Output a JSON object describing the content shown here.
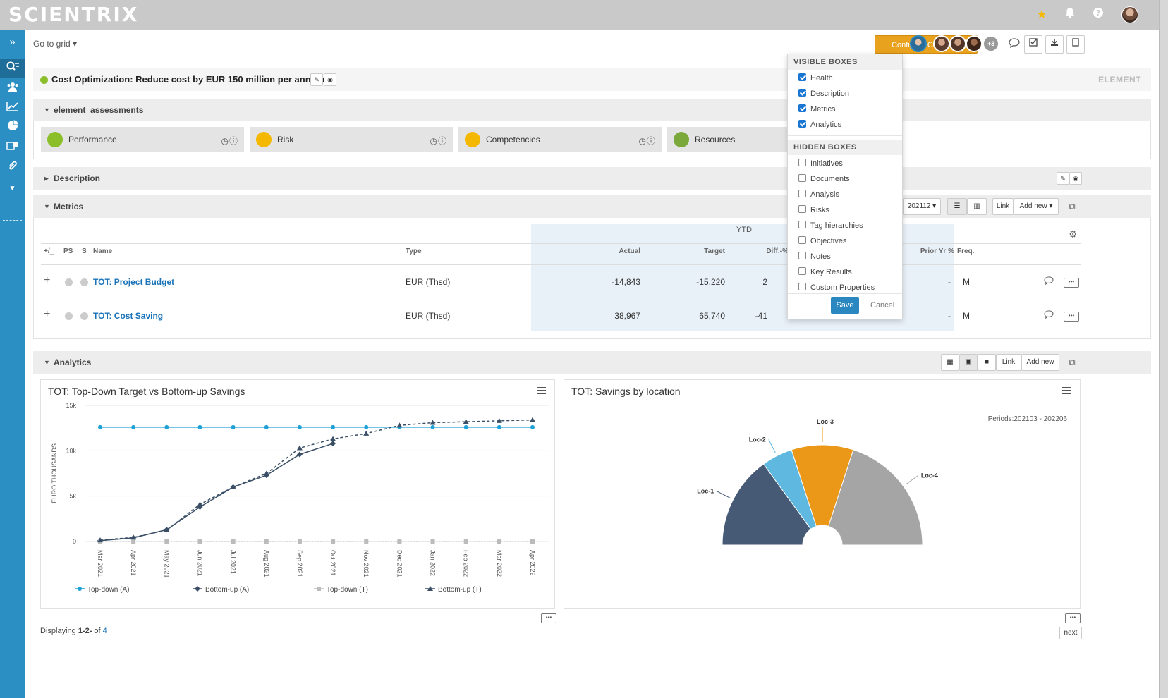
{
  "app": {
    "logo": "SCIENTRIX"
  },
  "topbar": {
    "icons": [
      "star-icon",
      "bell-icon",
      "help-icon",
      "user-avatar"
    ]
  },
  "nav": {
    "goto_grid": "Go to grid ▾"
  },
  "toolbar": {
    "configure_label": "Configure Content ▾",
    "more_users": "+3"
  },
  "element": {
    "title": "Cost Optimization: Reduce cost by EUR 150 million per annum",
    "type_label": "ELEMENT",
    "health_color": "#8bbf2a"
  },
  "sections": {
    "assessments": "element_assessments",
    "description": "Description",
    "metrics": "Metrics",
    "analytics": "Analytics"
  },
  "assessments": [
    {
      "label": "Performance",
      "color": "#8bbf2a"
    },
    {
      "label": "Risk",
      "color": "#f5b800"
    },
    {
      "label": "Competencies",
      "color": "#f5b800"
    },
    {
      "label": "Resources",
      "color": "#7aa83a"
    }
  ],
  "metrics": {
    "period": "202112 ▾",
    "link": "Link",
    "add_new": "Add new ▾",
    "ytd": "YTD",
    "headers": {
      "toggle": "+/_",
      "ps": "PS",
      "s": "S",
      "name": "Name",
      "type": "Type",
      "actual": "Actual",
      "target": "Target",
      "diff": "Diff.-%",
      "prior": "Prior Yr %",
      "freq": "Freq."
    },
    "rows": [
      {
        "name": "TOT: Project Budget",
        "type": "EUR (Thsd)",
        "actual": "-14,843",
        "target": "-15,220",
        "diff": "2",
        "prior": "-",
        "freq": "M"
      },
      {
        "name": "TOT: Cost Saving",
        "type": "EUR (Thsd)",
        "actual": "38,967",
        "target": "65,740",
        "diff": "-41",
        "prior": "-",
        "freq": "M"
      }
    ]
  },
  "analytics": {
    "link": "Link",
    "add_new": "Add new",
    "footer": {
      "prefix": "Displaying ",
      "range": "1-2-",
      "of": " of ",
      "total": "4"
    },
    "next": "next"
  },
  "dropdown": {
    "visible_head": "VISIBLE BOXES",
    "visible": [
      "Health",
      "Description",
      "Metrics",
      "Analytics"
    ],
    "hidden_head": "HIDDEN BOXES",
    "hidden": [
      "Initiatives",
      "Documents",
      "Analysis",
      "Risks",
      "Tag hierarchies",
      "Objectives",
      "Notes",
      "Key Results",
      "Custom Properties"
    ],
    "save": "Save",
    "cancel": "Cancel"
  },
  "chart_data": [
    {
      "type": "line",
      "title": "TOT: Top-Down Target vs Bottom-up Savings",
      "xlabel": "",
      "ylabel": "EURO THOUSANDS",
      "ylim": [
        0,
        15000
      ],
      "yticks": [
        "0",
        "5k",
        "10k",
        "15k"
      ],
      "categories": [
        "Mar 2021",
        "Apr 2021",
        "May 2021",
        "Jun 2021",
        "Jul 2021",
        "Aug 2021",
        "Sep 2021",
        "Oct 2021",
        "Nov 2021",
        "Dec 2021",
        "Jan 2022",
        "Feb 2022",
        "Mar 2022",
        "Apr 2022"
      ],
      "series": [
        {
          "name": "Top-down (A)",
          "color": "#1ea1d6",
          "values": [
            12600,
            12600,
            12600,
            12600,
            12600,
            12600,
            12600,
            12600,
            12600,
            12600,
            12600,
            12600,
            12600,
            12600
          ]
        },
        {
          "name": "Bottom-up (A)",
          "color": "#3a4f66",
          "values": [
            100,
            400,
            1300,
            3800,
            6000,
            7300,
            9600,
            10800,
            null,
            null,
            null,
            null,
            null,
            null
          ]
        },
        {
          "name": "Top-down (T)",
          "color": "#bbbbbb",
          "values": [
            0,
            0,
            0,
            0,
            0,
            0,
            0,
            0,
            0,
            0,
            0,
            0,
            0,
            0
          ]
        },
        {
          "name": "Bottom-up (T)",
          "color": "#3a4f66",
          "values": [
            150,
            450,
            1250,
            4100,
            6000,
            7500,
            10300,
            11300,
            11900,
            12800,
            13100,
            13200,
            13300,
            13400
          ]
        }
      ],
      "legend": "bottom"
    },
    {
      "type": "pie",
      "subtype": "semi-donut",
      "title": "TOT: Savings by location",
      "subtitle": "Periods:202103 - 202206",
      "categories": [
        "Loc-1",
        "Loc-2",
        "Loc-3",
        "Loc-4"
      ],
      "values": [
        30,
        10,
        20,
        40
      ],
      "colors": [
        "#465a75",
        "#5fb8df",
        "#eb9818",
        "#a5a5a5"
      ]
    }
  ]
}
